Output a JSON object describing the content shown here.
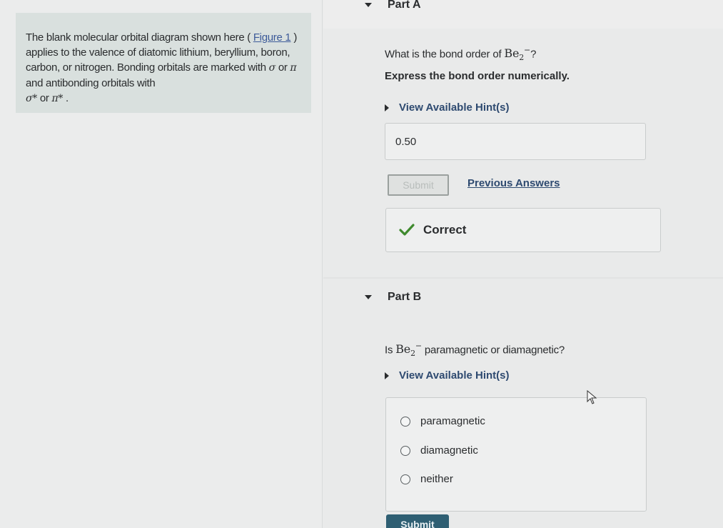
{
  "intro": {
    "text_1": "The blank molecular orbital diagram shown here (",
    "figure_link": "Figure 1",
    "text_2": ") applies to the valence of diatomic lithium, beryllium, boron, carbon, or nitrogen. Bonding orbitals are marked with ",
    "sigma": "σ",
    "or_1": " or ",
    "pi": "π",
    "text_3": " and antibonding orbitals with",
    "sigma_star": "σ*",
    "or_2": " or ",
    "pi_star": "π*",
    "period": "."
  },
  "part_a": {
    "header": "Part A",
    "question_prefix": "What is the bond order of ",
    "species_base": "Be",
    "species_sub": "2",
    "species_sup": "−",
    "question_suffix": "?",
    "instruction": "Express the bond order numerically.",
    "hint_label": "View Available Hint(s)",
    "answer_value": "0.50",
    "submit_label": "Submit",
    "previous_answers": "Previous Answers",
    "feedback": "Correct"
  },
  "part_b": {
    "header": "Part B",
    "question_prefix": "Is ",
    "species_base": "Be",
    "species_sub": "2",
    "species_sup": "−",
    "question_suffix": " paramagnetic or diamagnetic?",
    "hint_label": "View Available Hint(s)",
    "options": [
      "paramagnetic",
      "diamagnetic",
      "neither"
    ],
    "submit_label": "Submit"
  },
  "colors": {
    "link": "#2e4a70",
    "check": "#3f8a2e",
    "submit_bg": "#2f5f73"
  }
}
